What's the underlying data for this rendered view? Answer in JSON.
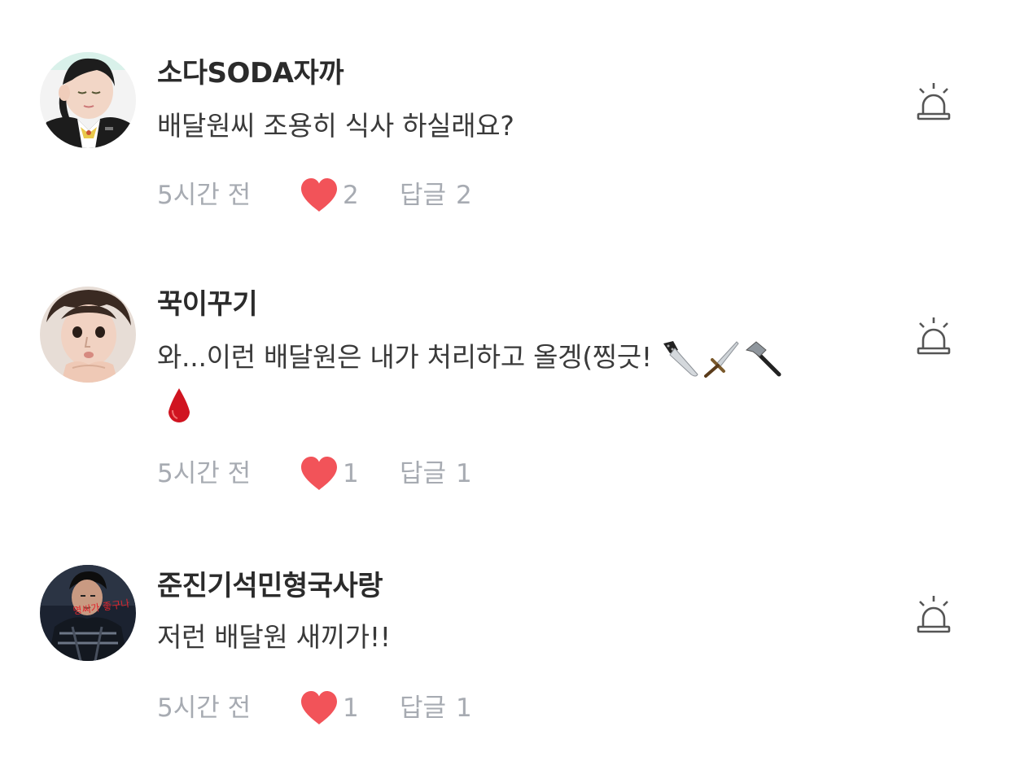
{
  "colors": {
    "heart": "#f25359",
    "meta_text": "#a7abb2",
    "author_text": "#2b2b2b",
    "body_text": "#3a3a3a",
    "report_icon": "#555555"
  },
  "comments": [
    {
      "author": "소다SODA자까",
      "text": "배달원씨 조용히 식사 하실래요?",
      "time": "5시간 전",
      "likes": "2",
      "reply_label": "답글",
      "reply_count": "2",
      "avatar_icon": "avatar-photo",
      "report_icon": "siren-icon"
    },
    {
      "author": "꾹이꾸기",
      "text": "와...이런 배달원은 내가 처리하고 올겡(찡긋!",
      "emojis": [
        "kitchen-knife-emoji",
        "dagger-emoji",
        "hammer-emoji",
        "drop-of-blood-emoji"
      ],
      "time": "5시간 전",
      "likes": "1",
      "reply_label": "답글",
      "reply_count": "1",
      "avatar_icon": "avatar-photo",
      "report_icon": "siren-icon"
    },
    {
      "author": "준진기석민형국사랑",
      "text": "저런 배달원 새끼가!!",
      "avatar_overlay_text": "명씨가 좋구나",
      "time": "5시간 전",
      "likes": "1",
      "reply_label": "답글",
      "reply_count": "1",
      "avatar_icon": "avatar-photo",
      "report_icon": "siren-icon"
    }
  ]
}
